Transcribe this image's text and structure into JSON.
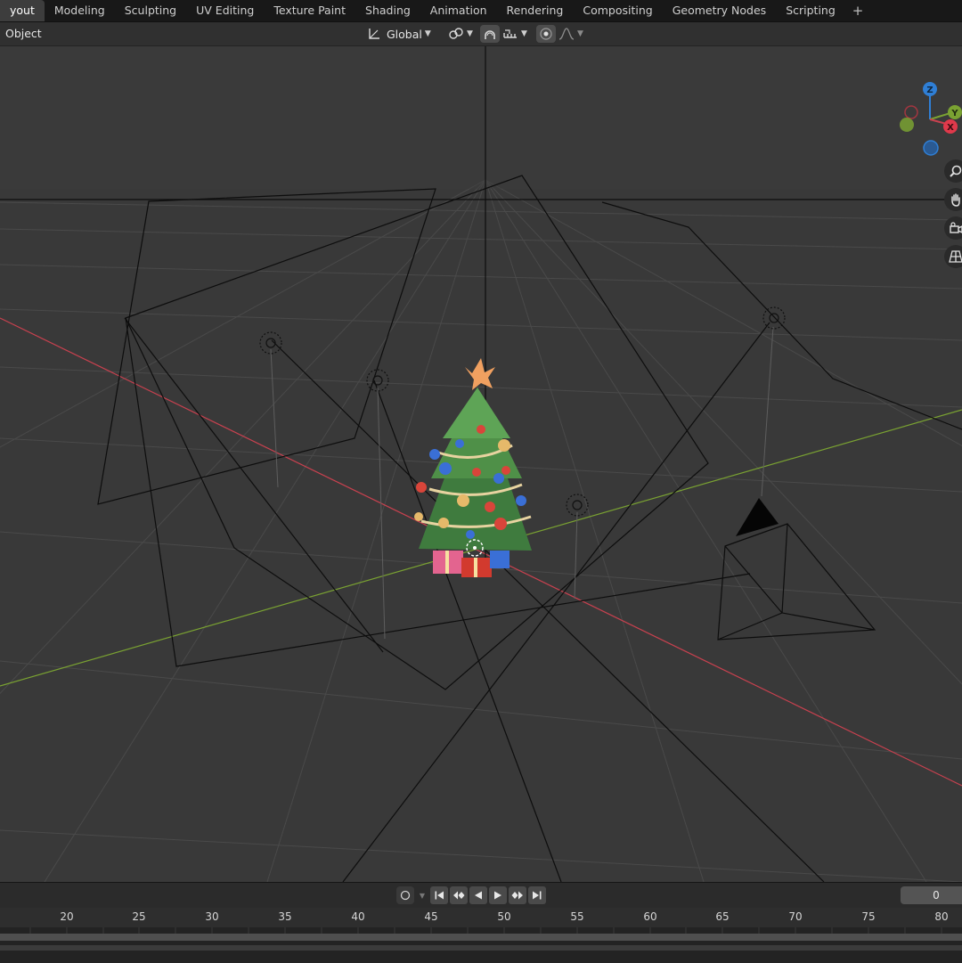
{
  "workspace_tabs": [
    {
      "label": "yout",
      "active": true
    },
    {
      "label": "Modeling",
      "active": false
    },
    {
      "label": "Sculpting",
      "active": false
    },
    {
      "label": "UV Editing",
      "active": false
    },
    {
      "label": "Texture Paint",
      "active": false
    },
    {
      "label": "Shading",
      "active": false
    },
    {
      "label": "Animation",
      "active": false
    },
    {
      "label": "Rendering",
      "active": false
    },
    {
      "label": "Compositing",
      "active": false
    },
    {
      "label": "Geometry Nodes",
      "active": false
    },
    {
      "label": "Scripting",
      "active": false
    }
  ],
  "add_tab_label": "+",
  "header": {
    "mode": "Object",
    "transform_orientation": "Global"
  },
  "gizmo": {
    "z": "Z",
    "y": "Y",
    "x": "X"
  },
  "icons": {
    "orientation": "orientation-icon",
    "pivot": "pivot-link-icon",
    "snap": "snap-magnet-icon",
    "snap_target": "snap-increment-icon",
    "proportional": "proportional-edit-icon",
    "falloff": "falloff-curve-icon",
    "zoom": "zoom-icon",
    "pan": "hand-pan-icon",
    "camera": "camera-view-icon",
    "grid": "perspective-grid-icon"
  },
  "timeline": {
    "current_frame": "0",
    "ruler_labels": [
      "20",
      "25",
      "30",
      "35",
      "40",
      "45",
      "50",
      "55",
      "60",
      "65",
      "70",
      "75",
      "80"
    ]
  },
  "colors": {
    "x_axis": "#c8414f",
    "y_axis": "#7aa232",
    "z_axis": "#2f7fd6",
    "viewport_bg": "#393939"
  }
}
